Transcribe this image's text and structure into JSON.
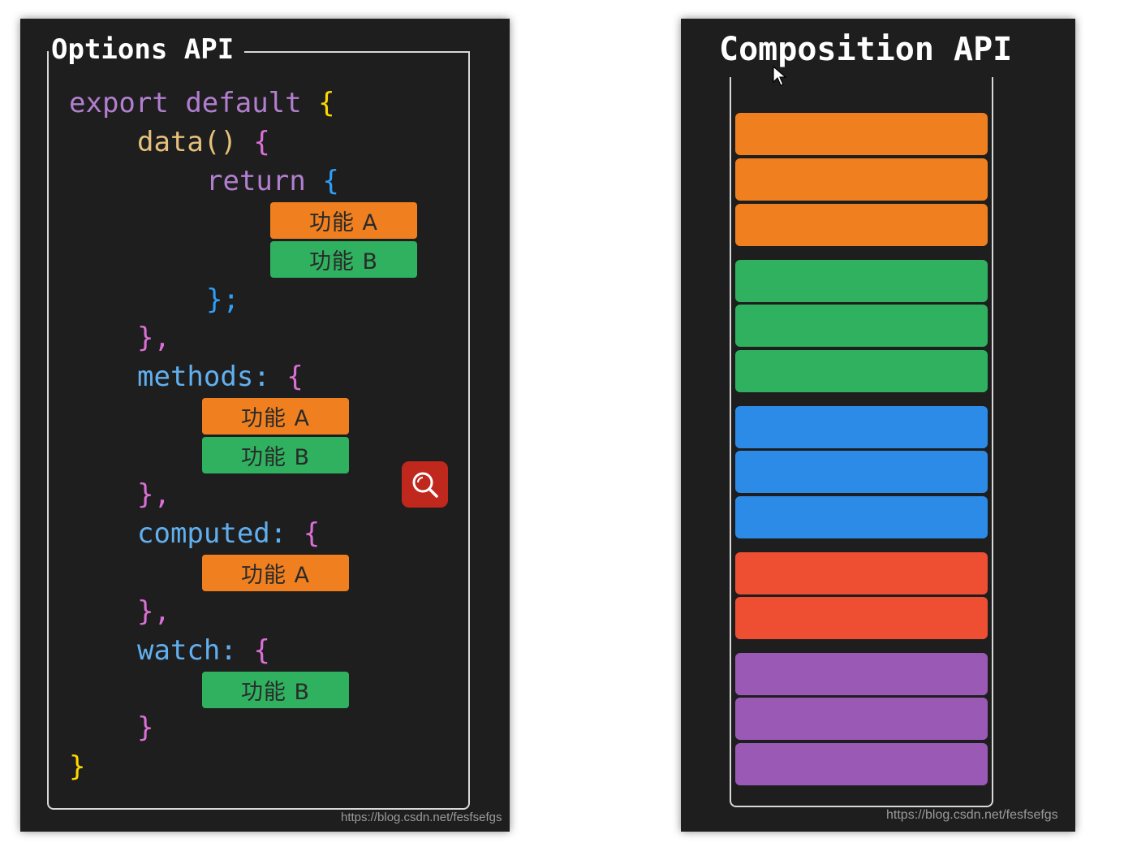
{
  "left_panel": {
    "title": "Options API",
    "code": {
      "export": "export",
      "default": "default",
      "open_brace": "{",
      "data_fn": "data()",
      "return_kw": "return",
      "semicolon_close": "};",
      "close_comma": "},",
      "methods_key": "methods:",
      "computed_key": "computed:",
      "watch_key": "watch:",
      "close_brace": "}"
    },
    "feature_a": "功能 A",
    "feature_b": "功能 B",
    "watermark": "https://blog.csdn.net/fesfsefgs"
  },
  "right_panel": {
    "title": "Composition API",
    "watermark": "https://blog.csdn.net/fesfsefgs",
    "blocks": [
      {
        "color": "#f0801f"
      },
      {
        "color": "#f0801f"
      },
      {
        "color": "#f0801f"
      },
      {
        "color": "#2fb15f"
      },
      {
        "color": "#2fb15f"
      },
      {
        "color": "#2fb15f"
      },
      {
        "color": "#2b8be6"
      },
      {
        "color": "#2b8be6"
      },
      {
        "color": "#2b8be6"
      },
      {
        "color": "#ee4f33"
      },
      {
        "color": "#ee4f33"
      },
      {
        "color": "#9b59b6"
      },
      {
        "color": "#9b59b6"
      },
      {
        "color": "#9b59b6"
      }
    ]
  },
  "icons": {
    "search": "search-icon",
    "cursor": "mouse-cursor-icon"
  }
}
